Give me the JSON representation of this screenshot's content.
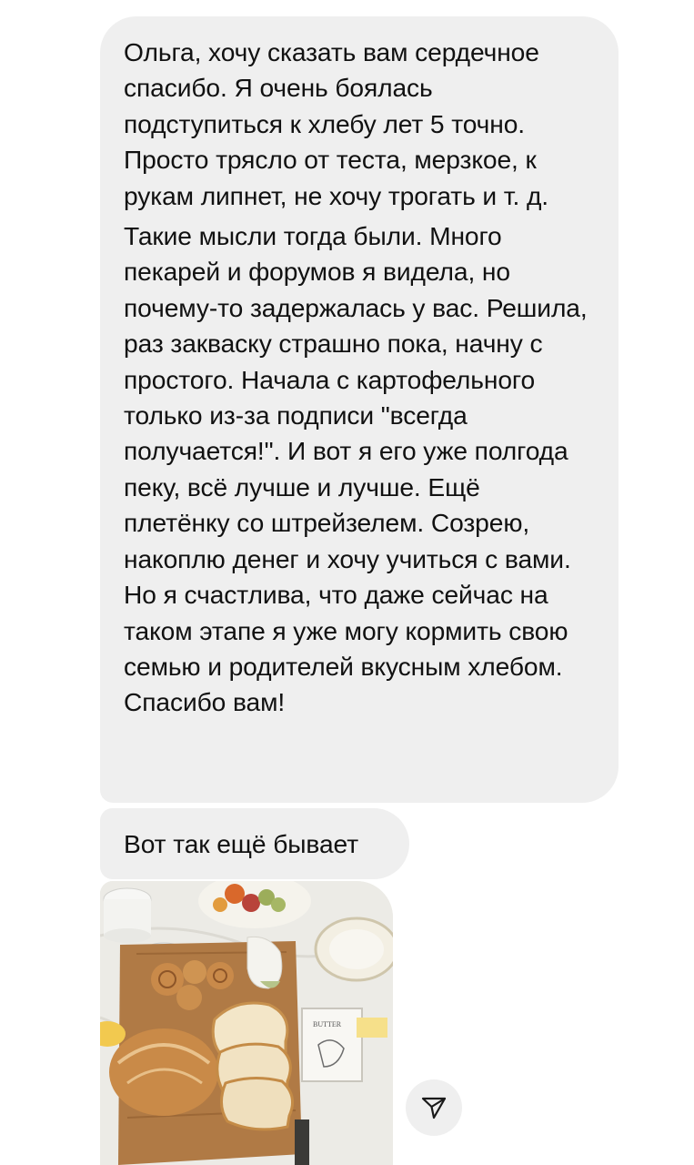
{
  "messages": {
    "first": {
      "paragraph_1": "Ольга, хочу сказать вам сердечное спасибо. Я очень боялась подступиться к хлебу лет 5 точно. Просто трясло от теста, мерзкое, к рукам липнет, не хочу трогать и т. д.",
      "paragraph_2": "Такие мысли тогда были. Много пекарей и форумов я видела, но почему-то задержалась у вас. Решила, раз закваску страшно пока, начну с простого. Начала с картофельного только из-за подписи \"всегда получается!\". И вот я его уже полгода пеку, всё лучше и лучше. Ещё плетёнку со штрейзелем. Созрею, накоплю денег и хочу учиться с вами. Но я счастлива, что даже сейчас на таком этапе я уже могу кормить свою семью и родителей вкусным хлебом. Спасибо вам!"
    },
    "second": {
      "text": "Вот так ещё бывает"
    },
    "photo": {
      "jar_label": "BUTTER"
    }
  },
  "icons": {
    "share": "paper-plane-icon"
  },
  "colors": {
    "bubble": "#efefef",
    "text": "#111111",
    "background": "#ffffff"
  }
}
